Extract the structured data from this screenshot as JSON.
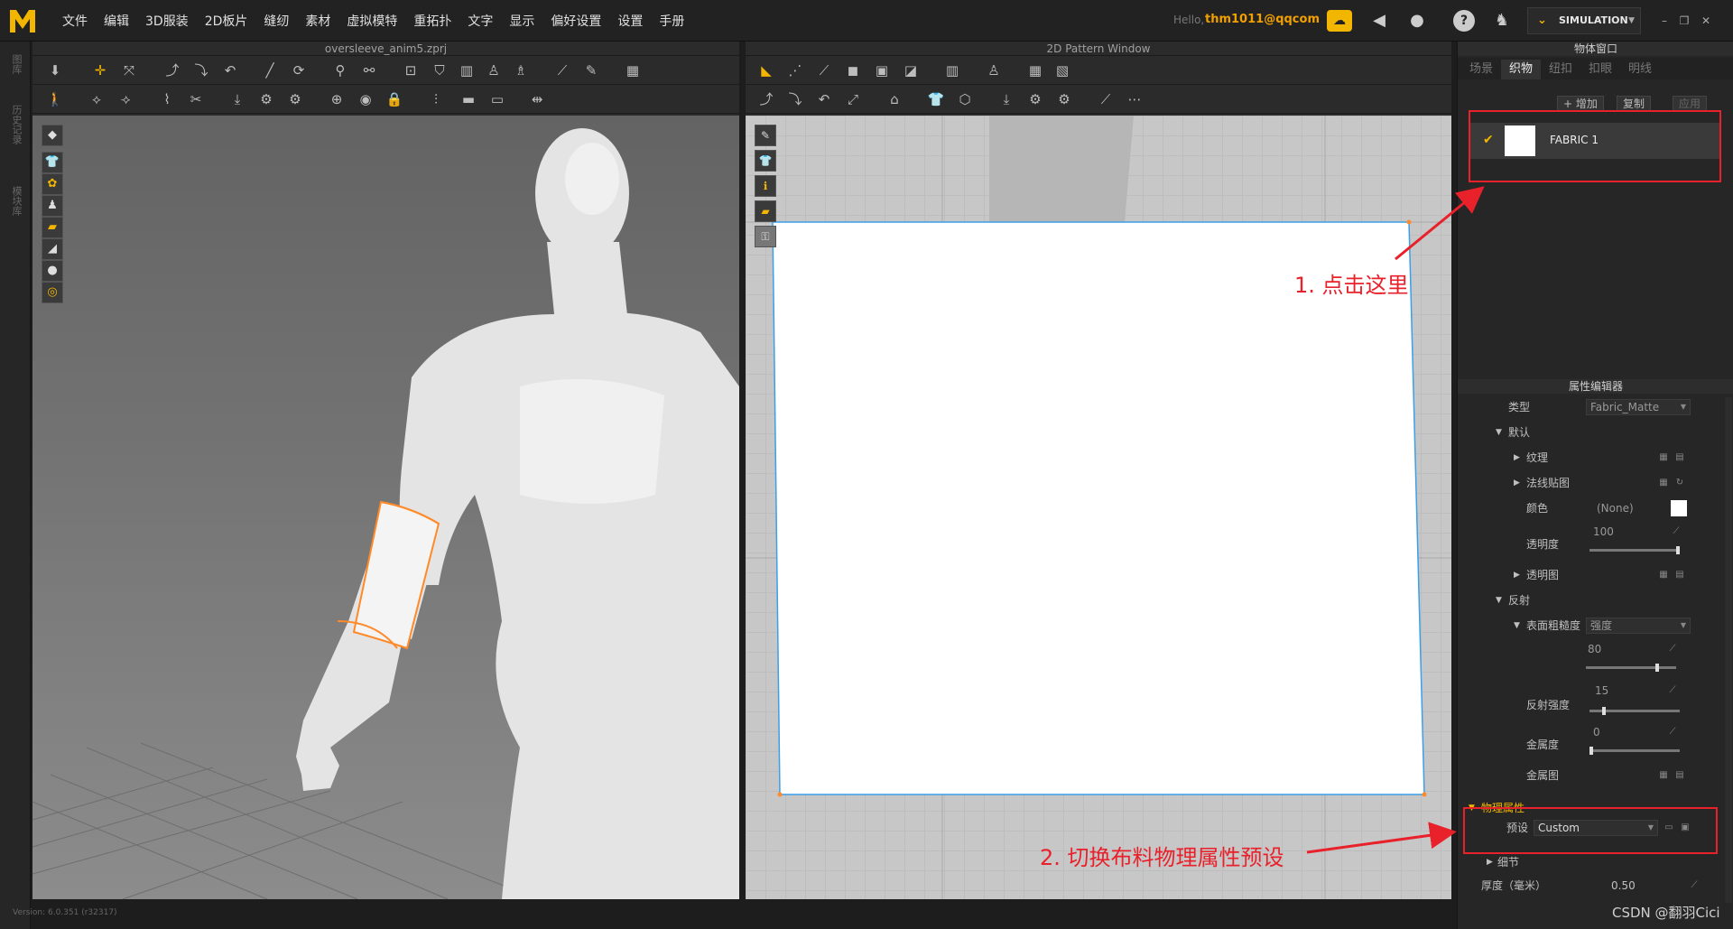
{
  "menubar": {
    "items": [
      "文件",
      "编辑",
      "3D服装",
      "2D板片",
      "缝纫",
      "素材",
      "虚拟模特",
      "重拓扑",
      "文字",
      "显示",
      "偏好设置",
      "设置",
      "手册"
    ],
    "hello": "Hello,",
    "user": "thm1011@qqcom",
    "mode_button": "SIMULATION"
  },
  "left_strip": {
    "tabs": [
      "图库",
      "历史记录",
      "模块库"
    ]
  },
  "window3d": {
    "title": "oversleeve_anim5.zprj"
  },
  "window2d": {
    "title": "2D Pattern Window"
  },
  "object_panel": {
    "title": "物体窗口",
    "tabs": [
      "场景",
      "织物",
      "纽扣",
      "扣眼",
      "明线"
    ],
    "active_tab": "织物",
    "add_button": "+ 增加",
    "copy_button": "复制",
    "apply_button": "应用",
    "fabric_name": "FABRIC 1"
  },
  "property_editor": {
    "title": "属性编辑器",
    "type_label": "类型",
    "type_value": "Fabric_Matte",
    "default_section": "默认",
    "texture_label": "纹理",
    "normal_map_label": "法线贴图",
    "color_label": "颜色",
    "color_value": "(None)",
    "opacity_label": "透明度",
    "opacity_value": "100",
    "opacity_level": 1.0,
    "opacity_map_label": "透明图",
    "reflection_section": "反射",
    "roughness_label": "表面粗糙度",
    "roughness_type": "强度",
    "roughness_value": "80",
    "roughness_level": 0.8,
    "reflect_label": "反射强度",
    "reflect_value": "15",
    "reflect_level": 0.15,
    "metal_label": "金属度",
    "metal_value": "0",
    "metal_level": 0.0,
    "metal_map_label": "金属图",
    "physics_section": "物理属性",
    "preset_label": "预设",
    "preset_value": "Custom",
    "detail_label": "细节",
    "thickness_label": "厚度（毫米）",
    "thickness_value": "0.50"
  },
  "annotations": {
    "step1": "1. 点击这里",
    "step2": "2. 切换布料物理属性预设"
  },
  "footer": {
    "version": "Version: 6.0.351 (r32317)",
    "watermark": "CSDN @翻羽Cici"
  },
  "colors": {
    "accent": "#f2a000",
    "annotation": "#e8212b",
    "pattern_outline": "#3aa0e8",
    "seam_line": "#ff8a2a"
  }
}
